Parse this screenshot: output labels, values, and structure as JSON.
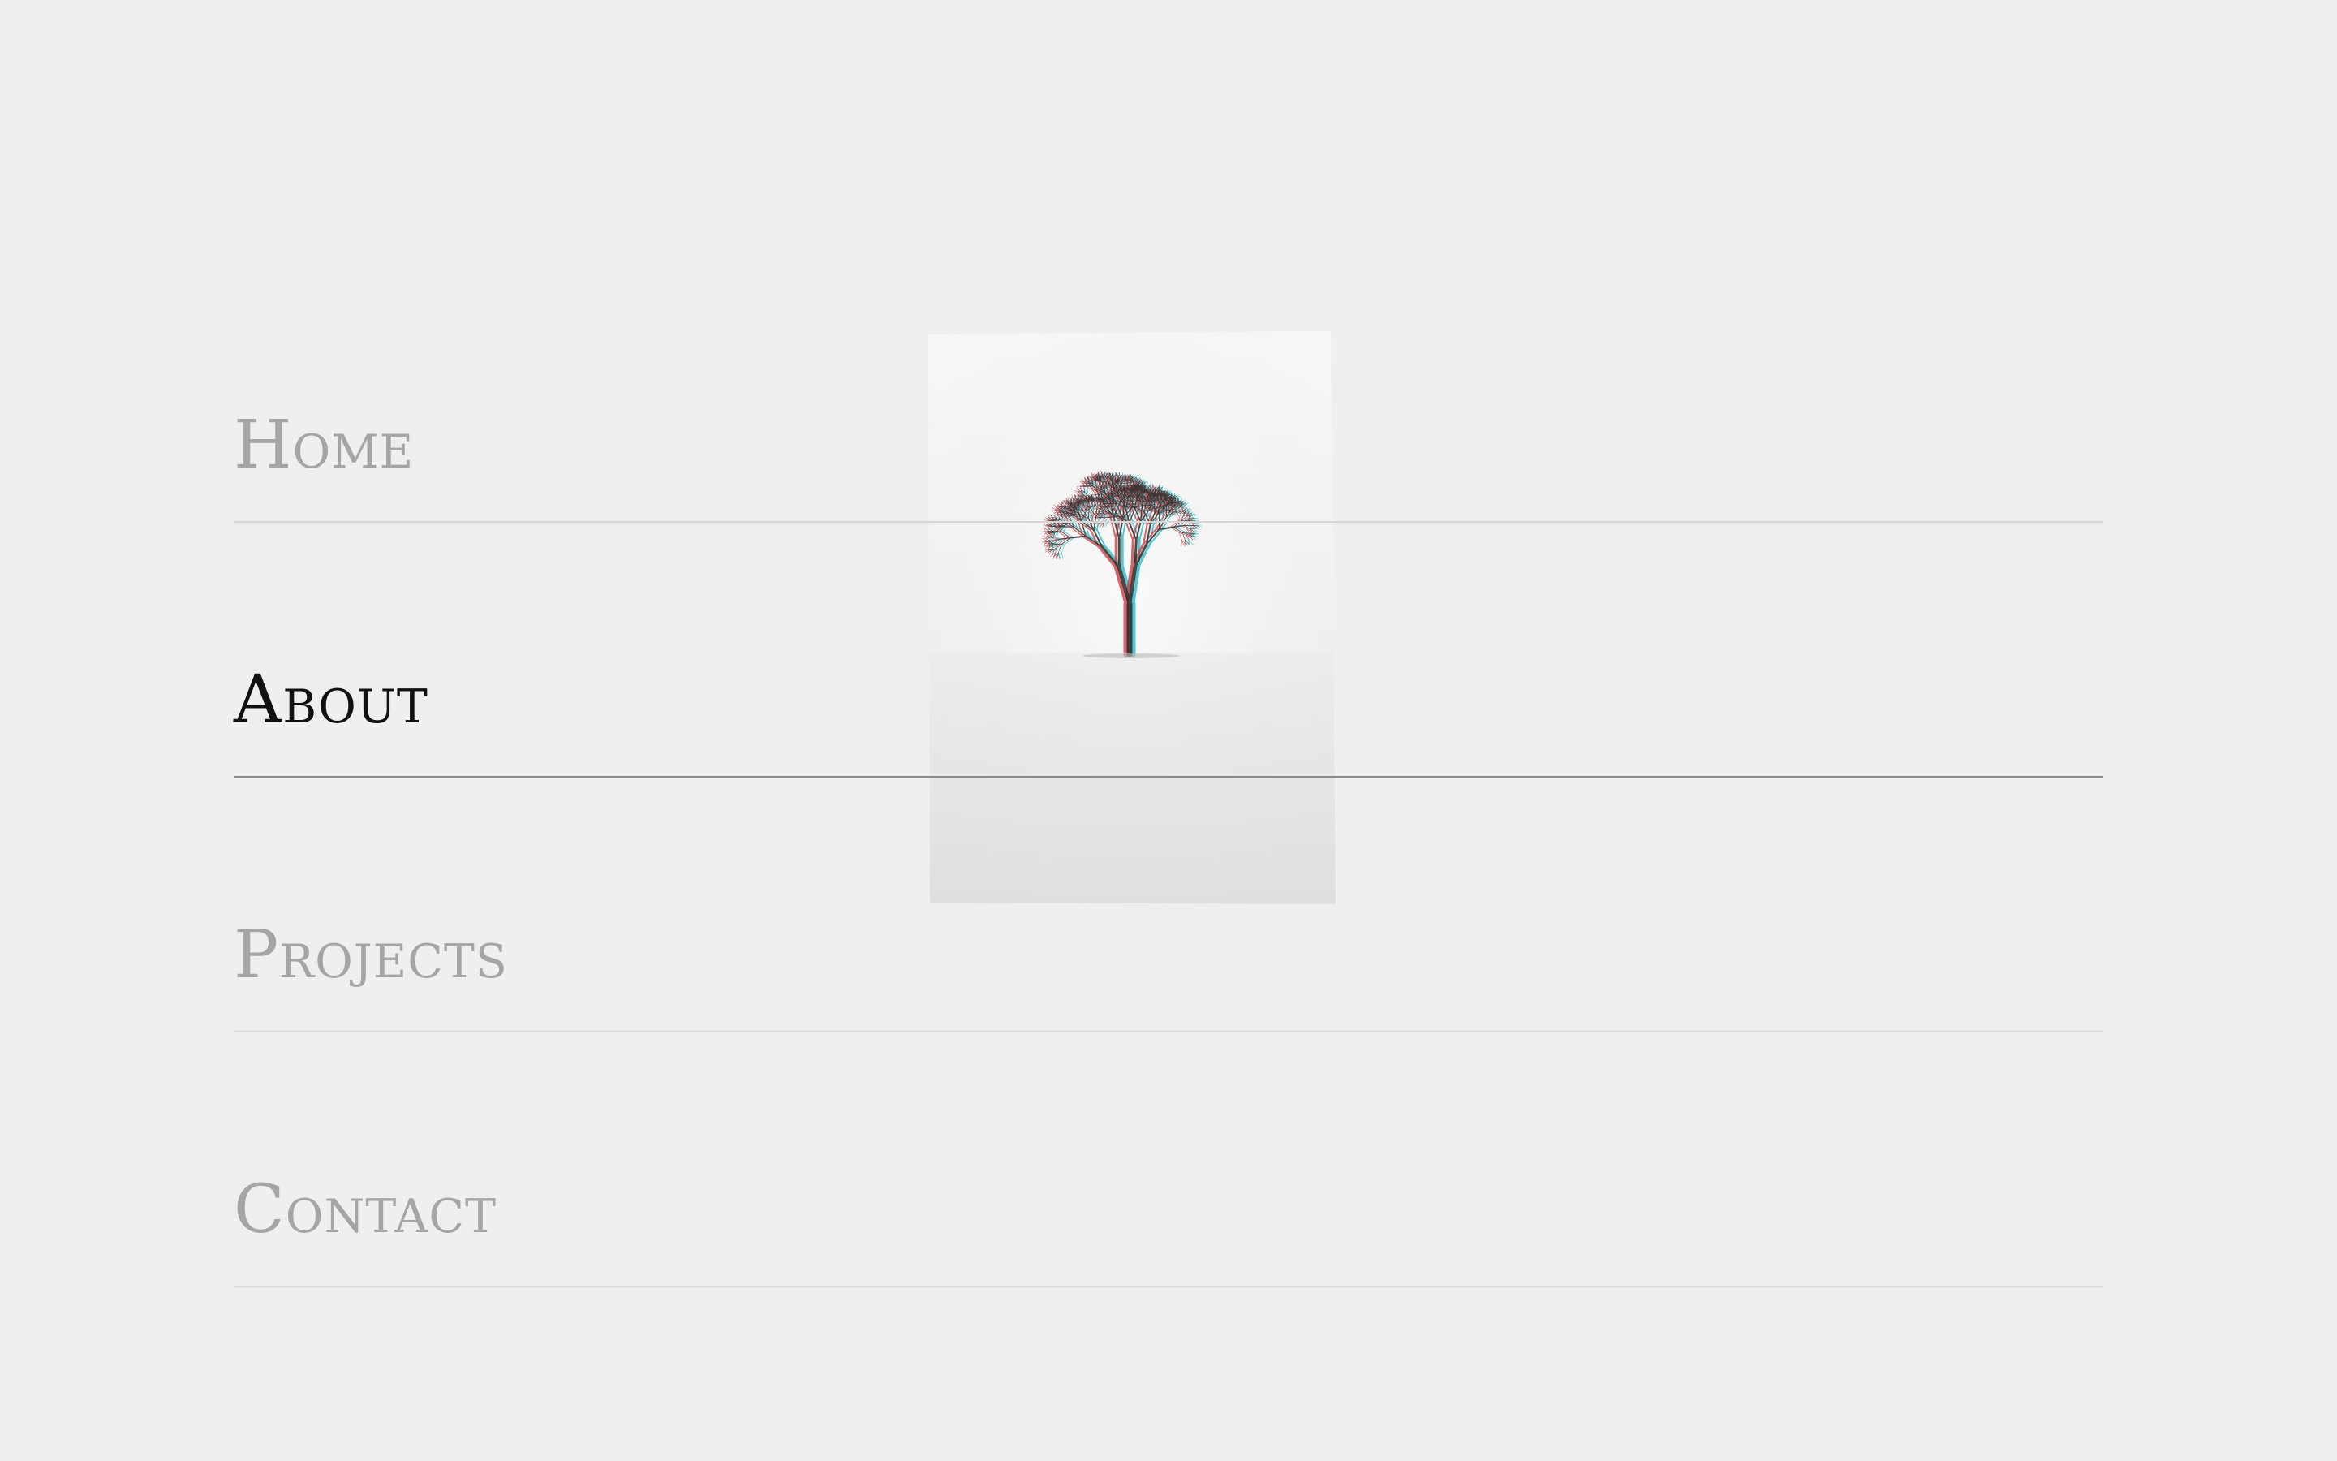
{
  "colors": {
    "background": "#efefef",
    "active_text": "#111111",
    "inactive_text": "#a5a5a5",
    "active_rule": "#8a8a8a",
    "inactive_rule": "#d5d5d5",
    "preview_sky_top": "#f6f6f6",
    "preview_ground": "#e3e3e3",
    "tree_dark": "#2b2b2b",
    "tree_red": "#c8353b",
    "tree_cyan": "#22b7c2"
  },
  "menu": {
    "items": [
      {
        "label": "Home",
        "active": false
      },
      {
        "label": "About",
        "active": true
      },
      {
        "label": "Projects",
        "active": false
      },
      {
        "label": "Contact",
        "active": false
      }
    ]
  },
  "preview": {
    "image": "lone-tree-in-snow",
    "visible": true
  }
}
